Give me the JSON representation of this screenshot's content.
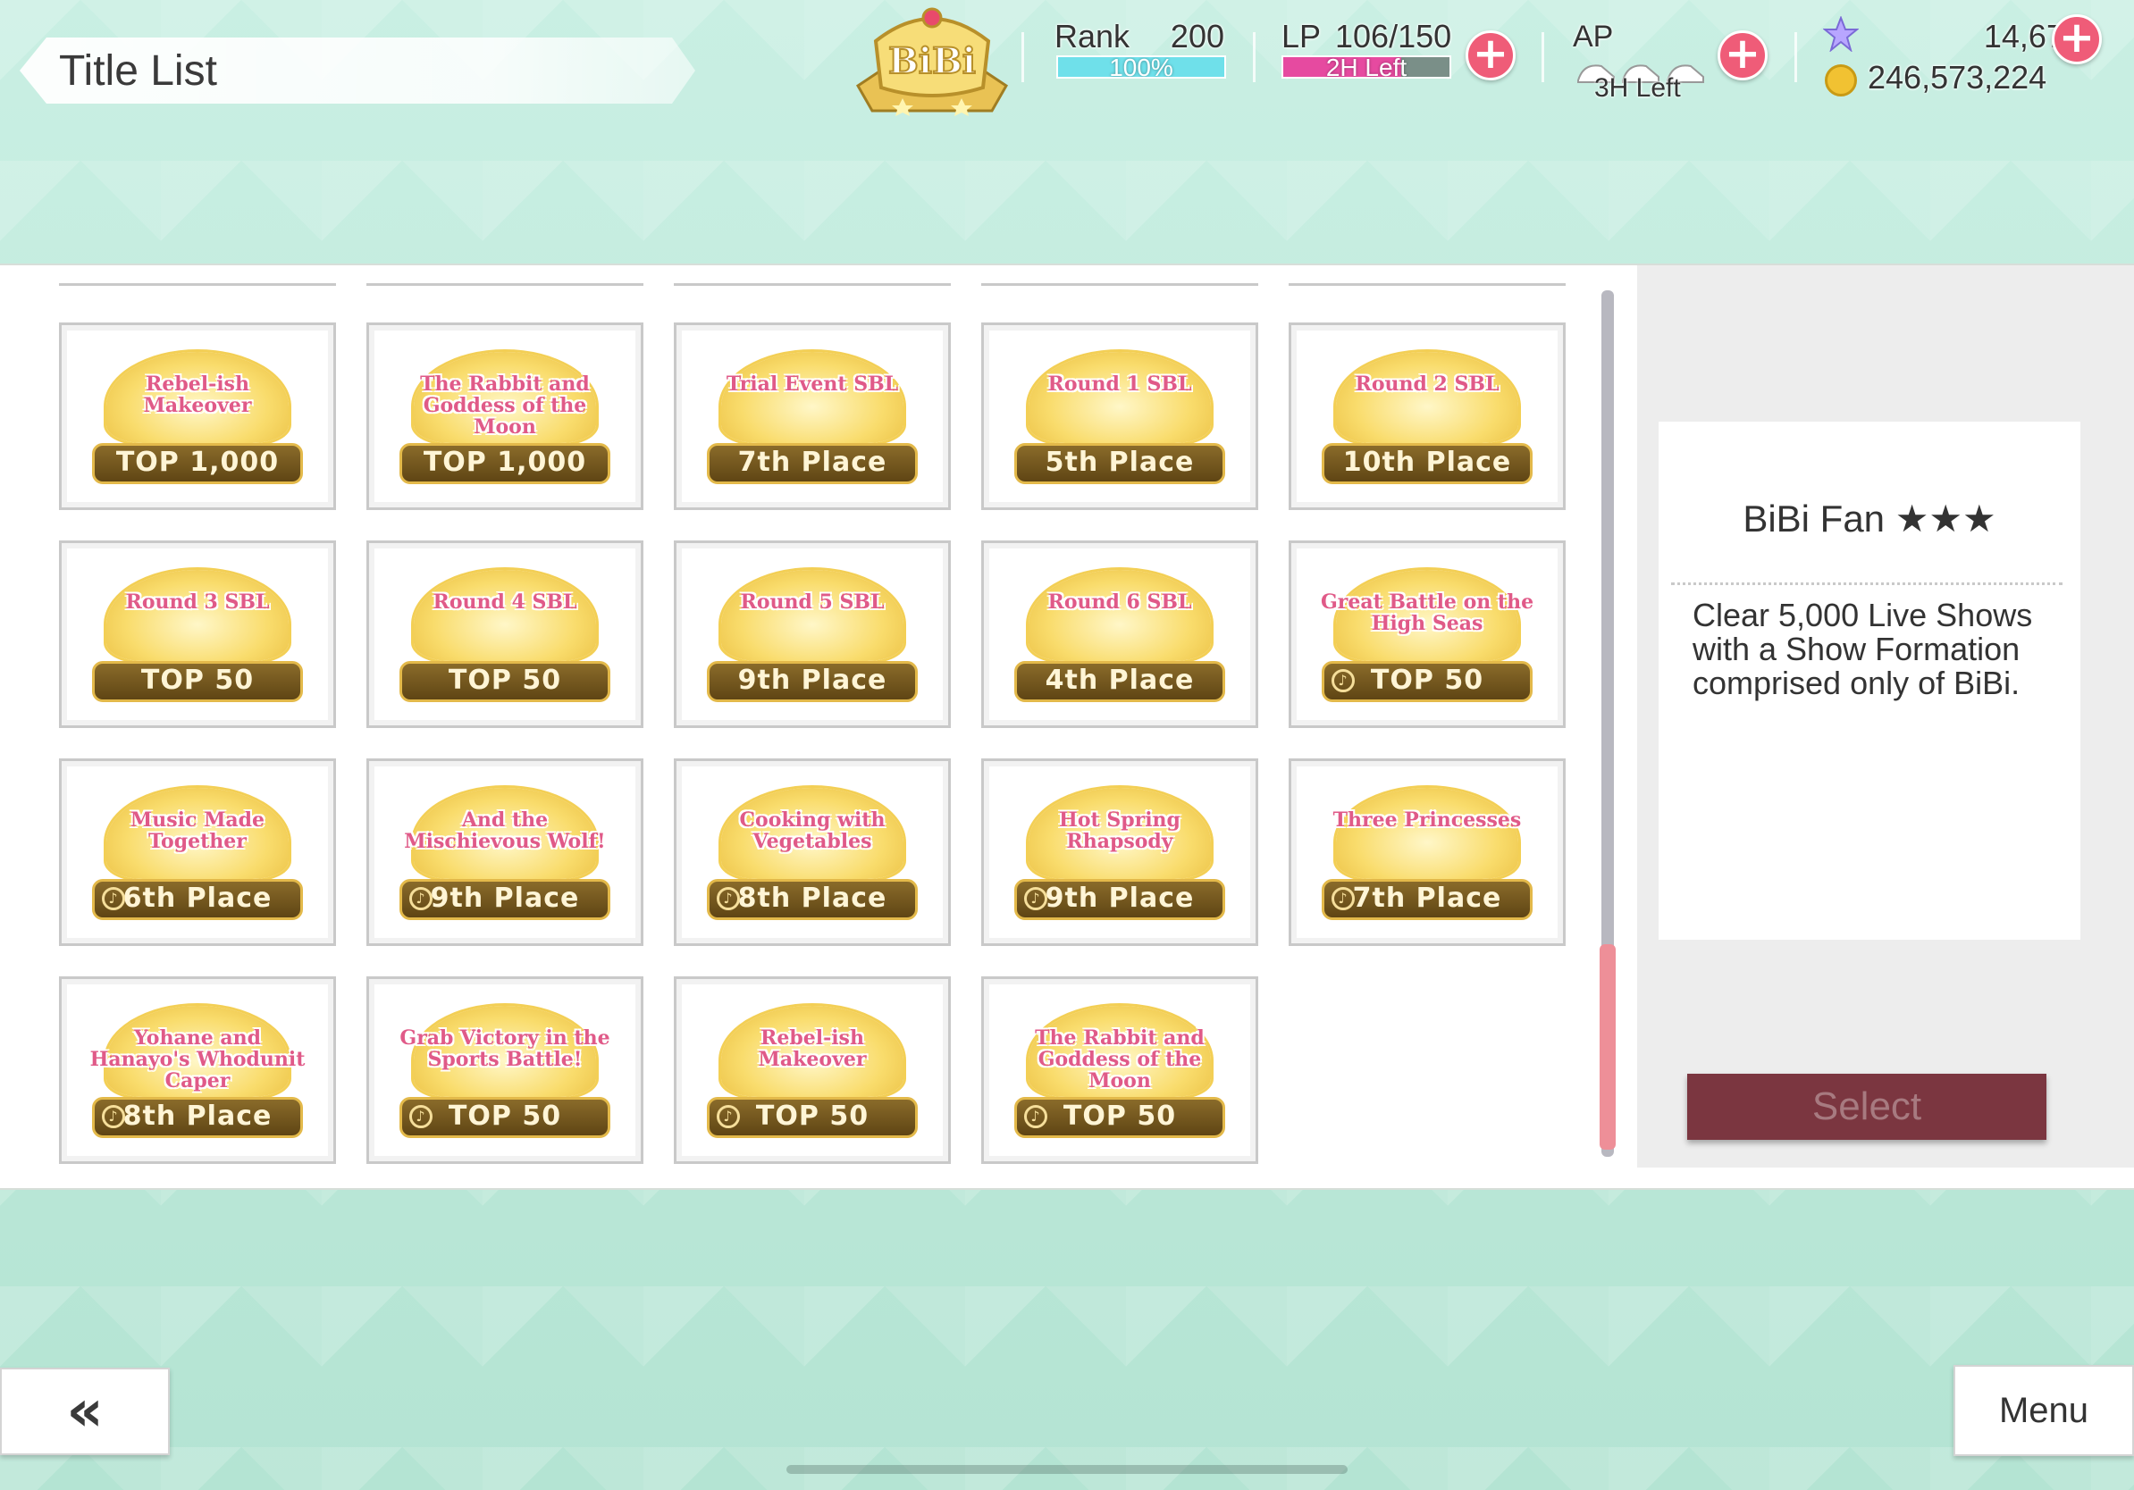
{
  "header": {
    "title": "Title List",
    "emblem": "BiBi",
    "rank": {
      "label": "Rank",
      "value": "200",
      "progress_text": "100%",
      "progress": 1.0
    },
    "lp": {
      "label": "LP",
      "value": "106/150",
      "timer": "2H Left",
      "fill": 0.71
    },
    "ap": {
      "label": "AP",
      "timer": "3H Left"
    },
    "gems": "14,675",
    "coins": "246,573,224"
  },
  "titles": [
    {
      "name": "Rebel-ish Makeover",
      "badge": "TOP 1,000",
      "note": false
    },
    {
      "name": "The Rabbit and Goddess of the Moon",
      "badge": "TOP 1,000",
      "note": false
    },
    {
      "name": "Trial Event SBL",
      "badge": "7th Place",
      "note": false
    },
    {
      "name": "Round 1 SBL",
      "badge": "5th Place",
      "note": false
    },
    {
      "name": "Round 2 SBL",
      "badge": "10th Place",
      "note": false
    },
    {
      "name": "Round 3 SBL",
      "badge": "TOP 50",
      "note": false
    },
    {
      "name": "Round 4 SBL",
      "badge": "TOP 50",
      "note": false
    },
    {
      "name": "Round 5 SBL",
      "badge": "9th Place",
      "note": false
    },
    {
      "name": "Round 6 SBL",
      "badge": "4th Place",
      "note": false
    },
    {
      "name": "Great Battle on the High Seas",
      "badge": "TOP 50",
      "note": true
    },
    {
      "name": "Music Made Together",
      "badge": "6th Place",
      "note": true
    },
    {
      "name": "And the Mischievous Wolf!",
      "badge": "9th Place",
      "note": true
    },
    {
      "name": "Cooking with Vegetables",
      "badge": "8th Place",
      "note": true
    },
    {
      "name": "Hot Spring Rhapsody",
      "badge": "9th Place",
      "note": true
    },
    {
      "name": "Three Princesses",
      "badge": "7th Place",
      "note": true
    },
    {
      "name": "Yohane and Hanayo's Whodunit Caper",
      "badge": "8th Place",
      "note": true
    },
    {
      "name": "Grab Victory in the Sports Battle!",
      "badge": "TOP 50",
      "note": true
    },
    {
      "name": "Rebel-ish Makeover",
      "badge": "TOP 50",
      "note": true
    },
    {
      "name": "The Rabbit and Goddess of the Moon",
      "badge": "TOP 50",
      "note": true
    }
  ],
  "detail": {
    "title": "BiBi Fan ★★★",
    "description": "Clear 5,000 Live Shows with a Show Formation comprised only of BiBi.",
    "select_label": "Select"
  },
  "footer": {
    "back_label": "«",
    "menu_label": "Menu"
  }
}
